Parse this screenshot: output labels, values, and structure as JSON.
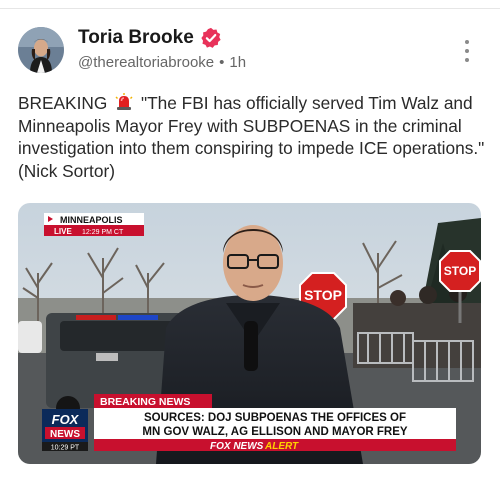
{
  "post": {
    "author_name": "Toria Brooke",
    "handle": "@therealtoriabrooke",
    "separator": "•",
    "time": "1h",
    "text_prefix": "BREAKING",
    "text_body": "\"The FBI has officially served Tim Walz and Minneapolis Mayor Frey with SUBPOENAS in the criminal investigation into them conspiring to impede ICE operations.\" (Nick Sortor)",
    "icons": {
      "verified": "verified-badge-icon",
      "more": "more-vertical-icon",
      "siren": "siren-emoji-icon"
    },
    "colors": {
      "verified": "#e8325a",
      "handle": "#666666"
    }
  },
  "media": {
    "location": "MINNEAPOLIS",
    "live": "LIVE",
    "time": "12:29 PM CT",
    "stop_sign_left": "STOP",
    "stop_sign_right": "STOP",
    "breaking_news": "BREAKING NEWS",
    "headline_line1": "SOURCES: DOJ SUBPOENAS THE OFFICES OF",
    "headline_line2": "MN GOV WALZ, AG ELLISON AND MAYOR FREY",
    "alert_prefix": "FOX NEWS",
    "alert_suffix": "ALERT",
    "logo_top": "FOX",
    "logo_bottom": "NEWS",
    "logo_time": "10:29 PT",
    "colors": {
      "breaking": "#c8102e",
      "alert_yellow": "#ffd200",
      "navy": "#0b2a5a"
    }
  }
}
